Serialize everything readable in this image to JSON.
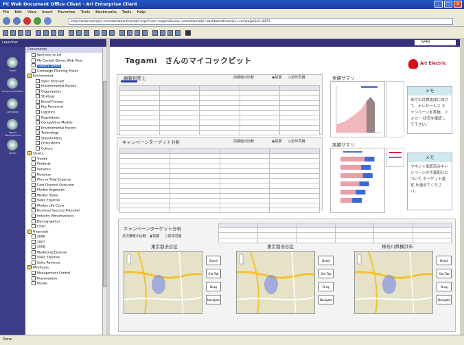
{
  "window": {
    "title": "PC Web Document Office Client - Ari Enterprise Client"
  },
  "menu": [
    "File",
    "Edit",
    "View",
    "Insert",
    "Favorites",
    "Tools",
    "Bookmarks",
    "Tools",
    "Help"
  ],
  "address": {
    "url": "http://www.example.com/dashboard/cockpit.aspx?user=tagami&view=cockpit&mode=dashboard&section=campaign&id=4473"
  },
  "sidebar": {
    "header": "Launcher",
    "icons": [
      {
        "name": "portal-icon",
        "label": "Portal"
      },
      {
        "name": "analysis-icon",
        "label": "Analysis Activities"
      },
      {
        "name": "campaign-icon",
        "label": "Campaign"
      },
      {
        "name": "report-icon",
        "label": "Report Management"
      },
      {
        "name": "admin-icon",
        "label": "Admin"
      }
    ]
  },
  "tree": {
    "header": "Documents",
    "items": [
      {
        "label": "Welcome to Art",
        "level": 1
      },
      {
        "label": "My Cockpit Demo, Web View",
        "level": 1
      },
      {
        "label": "Gallery Demo",
        "level": 1,
        "selected": true
      },
      {
        "label": "Campaign Planning Sheet",
        "level": 1
      },
      {
        "label": "Environment",
        "level": 0
      },
      {
        "label": "Sales Forecast",
        "level": 2
      },
      {
        "label": "Environmental Factors",
        "level": 2
      },
      {
        "label": "Organization",
        "level": 2
      },
      {
        "label": "Strategy",
        "level": 2
      },
      {
        "label": "Brand Process",
        "level": 2
      },
      {
        "label": "Key Personnel",
        "level": 2
      },
      {
        "label": "Logistics",
        "level": 2
      },
      {
        "label": "Regulations",
        "level": 2
      },
      {
        "label": "Competitive Models",
        "level": 2
      },
      {
        "label": "Environmental Factors",
        "level": 2
      },
      {
        "label": "Technology",
        "level": 2
      },
      {
        "label": "Stakeholders",
        "level": 2
      },
      {
        "label": "Ecosystems",
        "level": 2
      },
      {
        "label": "Culture",
        "level": 2
      },
      {
        "label": "Charts",
        "level": 0
      },
      {
        "label": "Trends",
        "level": 1
      },
      {
        "label": "Products",
        "level": 1
      },
      {
        "label": "Variance",
        "level": 1
      },
      {
        "label": "Revenue",
        "level": 1
      },
      {
        "label": "Plan vs Total Expense",
        "level": 1
      },
      {
        "label": "Cost Channel Overview",
        "level": 1
      },
      {
        "label": "Market Segments",
        "level": 1
      },
      {
        "label": "Market Share",
        "level": 1
      },
      {
        "label": "Sales Expense",
        "level": 1
      },
      {
        "label": "Market Life Cycle",
        "level": 1
      },
      {
        "label": "Business Success Potential",
        "level": 1
      },
      {
        "label": "Industry Attractiveness",
        "level": 1
      },
      {
        "label": "Demographics",
        "level": 1
      },
      {
        "label": "Chart",
        "level": 1
      },
      {
        "label": "Financials",
        "level": 0
      },
      {
        "label": "2006",
        "level": 1
      },
      {
        "label": "2007",
        "level": 1
      },
      {
        "label": "2008",
        "level": 1
      },
      {
        "label": "Marketing Expense",
        "level": 1
      },
      {
        "label": "Sales Expense",
        "level": 1
      },
      {
        "label": "Sales Revenue",
        "level": 1
      },
      {
        "label": "Miniframe",
        "level": 0
      },
      {
        "label": "Management Control",
        "level": 1
      },
      {
        "label": "Presentation",
        "level": 1
      },
      {
        "label": "Resale",
        "level": 1
      }
    ]
  },
  "userbox": {
    "label": "NAME"
  },
  "dashboard": {
    "title": "Tagami　さんのマイコックピット",
    "brand": "Art Electric",
    "radio_prev": "前期値の比較",
    "radio_on": "◉前期",
    "radio_off": "○前年同期",
    "panel1_title": "顧客別売上",
    "panel2_title": "キャンペーンターゲット分析",
    "chart1_title": "実績サマリ",
    "chart2_title": "実績サマリ",
    "memo_header": "メモ",
    "memo1_text": "来月の目標達成に向けて、テレセールス キャンペーンを実施、フォロー 状況を確認して下さい。",
    "memo2_text": "マネジャ承認済みキャンペーンの予算配分について ターゲット選定 を進めてください。",
    "map_section_title": "キャンペーンターゲット分析",
    "map_radio": "月次推移の比較",
    "map_radio_on": "◉前期",
    "map_radio_off": "○前年同期",
    "maps": [
      {
        "title": "東京都渋谷区",
        "buttons": [
          "Detail",
          "Get Tab",
          "Drag",
          "Navigate"
        ]
      },
      {
        "title": "東京都渋谷区",
        "buttons": [
          "Detail",
          "Get Tab",
          "Drag",
          "Navigate"
        ]
      },
      {
        "title": "神奈川県横浜市",
        "buttons": [
          "Detail",
          "Get Tab",
          "Drag",
          "Navigate"
        ]
      }
    ]
  },
  "status": {
    "text": "Done"
  }
}
